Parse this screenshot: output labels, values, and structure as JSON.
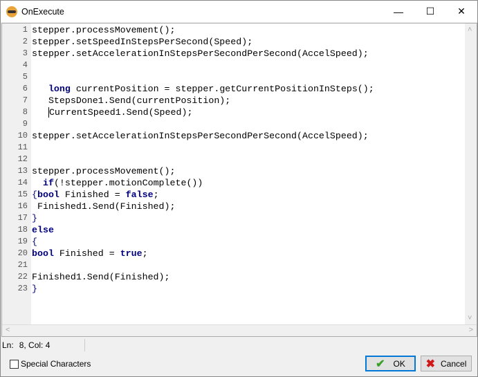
{
  "window": {
    "title": "OnExecute"
  },
  "editor": {
    "lines": [
      [
        [
          "n",
          "stepper.processMovement();"
        ]
      ],
      [
        [
          "n",
          "stepper.setSpeedInStepsPerSecond(Speed);"
        ]
      ],
      [
        [
          "n",
          "stepper.setAccelerationInStepsPerSecondPerSecond(AccelSpeed);"
        ]
      ],
      [],
      [],
      [
        [
          "n",
          "   "
        ],
        [
          "k",
          "long"
        ],
        [
          "n",
          " currentPosition = stepper.getCurrentPositionInSteps();"
        ]
      ],
      [
        [
          "n",
          "   StepsDone1.Send(currentPosition);"
        ]
      ],
      [
        [
          "n",
          "   "
        ],
        [
          "c",
          ""
        ],
        [
          "n",
          "CurrentSpeed1.Send(Speed);"
        ]
      ],
      [],
      [
        [
          "n",
          "stepper.setAccelerationInStepsPerSecondPerSecond(AccelSpeed);"
        ]
      ],
      [],
      [],
      [
        [
          "n",
          "stepper.processMovement();"
        ]
      ],
      [
        [
          "n",
          "  "
        ],
        [
          "k",
          "if"
        ],
        [
          "n",
          "(!stepper.motionComplete())"
        ]
      ],
      [
        [
          "b",
          "{"
        ],
        [
          "k",
          "bool"
        ],
        [
          "n",
          " Finished = "
        ],
        [
          "k",
          "false"
        ],
        [
          "n",
          ";"
        ]
      ],
      [
        [
          "n",
          " Finished1.Send(Finished);"
        ]
      ],
      [
        [
          "b",
          "}"
        ]
      ],
      [
        [
          "k",
          "else"
        ]
      ],
      [
        [
          "b",
          "{"
        ]
      ],
      [
        [
          "k",
          "bool"
        ],
        [
          "n",
          " Finished = "
        ],
        [
          "k",
          "true"
        ],
        [
          "n",
          ";"
        ]
      ],
      [],
      [
        [
          "n",
          "Finished1.Send(Finished);"
        ]
      ],
      [
        [
          "b",
          "}"
        ]
      ]
    ]
  },
  "status": {
    "ln_label": "Ln:",
    "ln_value": "8, Col: 4"
  },
  "footer": {
    "special_chars": "Special Characters",
    "ok": "OK",
    "cancel": "Cancel"
  }
}
